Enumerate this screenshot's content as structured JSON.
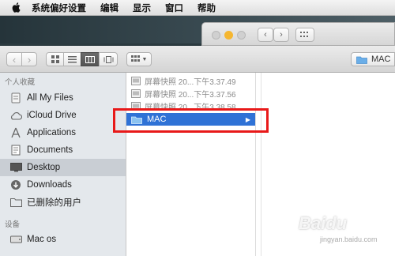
{
  "menubar": {
    "items": [
      "系统偏好设置",
      "编辑",
      "显示",
      "窗口",
      "帮助"
    ]
  },
  "toolbar": {
    "current_folder_label": "MAC"
  },
  "sidebar": {
    "favorites_header": "个人收藏",
    "items": [
      {
        "label": "All My Files",
        "icon": "all-files-icon"
      },
      {
        "label": "iCloud Drive",
        "icon": "cloud-icon"
      },
      {
        "label": "Applications",
        "icon": "applications-icon"
      },
      {
        "label": "Documents",
        "icon": "documents-icon"
      },
      {
        "label": "Desktop",
        "icon": "desktop-icon",
        "selected": true
      },
      {
        "label": "Downloads",
        "icon": "downloads-icon"
      },
      {
        "label": "已删除的用户",
        "icon": "folder-icon"
      }
    ],
    "devices_header": "设备",
    "devices": [
      {
        "label": "Mac os",
        "icon": "disk-icon"
      }
    ]
  },
  "column1": {
    "files": [
      "屏幕快照 20...下午3.37.49",
      "屏幕快照 20...下午3.37.56",
      "屏幕快照 20...下午3.38.58"
    ],
    "folder": "MAC"
  },
  "watermark": {
    "brand": "Baidu",
    "sub": "jingyan.baidu.com"
  },
  "colors": {
    "selection": "#2f72d6",
    "highlight_box": "#e81919"
  }
}
